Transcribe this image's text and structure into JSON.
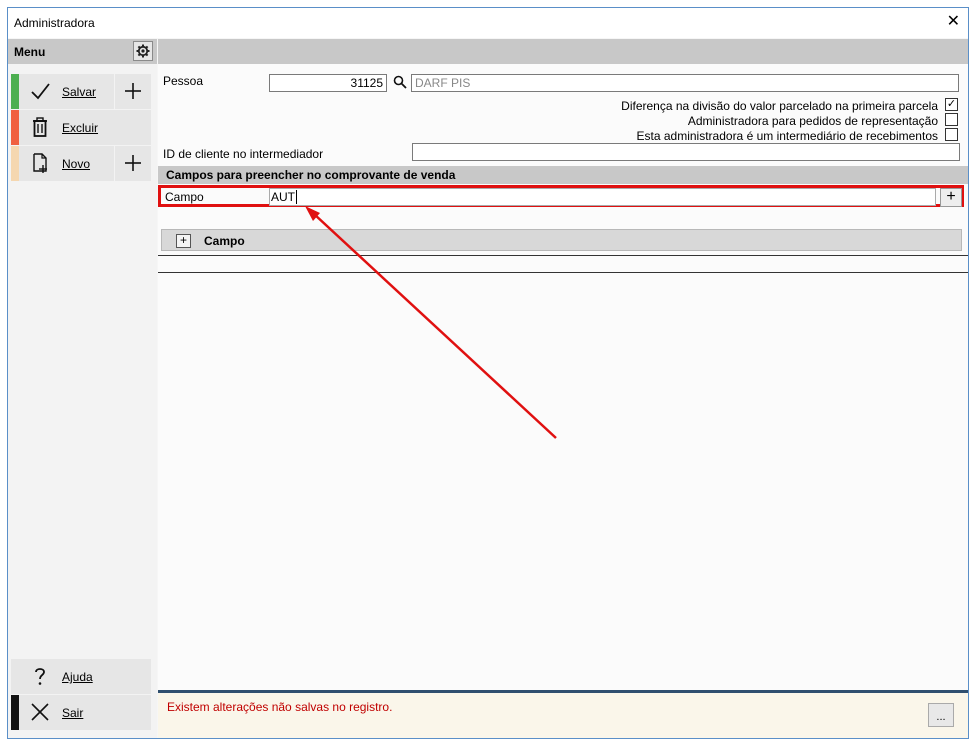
{
  "window": {
    "title": "Administradora",
    "close_glyph": "✕"
  },
  "sidebar": {
    "menu_label": "Menu",
    "settings_icon": "gear-icon",
    "buttons": [
      {
        "label": "Salvar",
        "icon": "check-icon",
        "color": "#4caf50",
        "has_plus": true
      },
      {
        "label": "Excluir",
        "icon": "trash-icon",
        "color": "#f06040",
        "has_plus": false
      },
      {
        "label": "Novo",
        "icon": "new-document-icon",
        "color": "#f5d7b0",
        "has_plus": true
      }
    ],
    "bottom_buttons": [
      {
        "label": "Ajuda",
        "icon": "help-icon"
      },
      {
        "label": "Sair",
        "icon": "close-icon",
        "color": "#111111"
      }
    ]
  },
  "form": {
    "pessoa_label": "Pessoa",
    "pessoa_code": "31125",
    "pessoa_name_placeholder": "DARF PIS",
    "checkboxes": [
      {
        "label": "Diferença na divisão do valor parcelado na primeira parcela",
        "checked": true
      },
      {
        "label": "Administradora para pedidos de representação",
        "checked": false
      },
      {
        "label": "Esta administradora é um intermediário de recebimentos",
        "checked": false
      }
    ],
    "client_id_label": "ID de cliente no intermediador",
    "client_id_value": ""
  },
  "section": {
    "title": "Campos para preencher no comprovante de venda",
    "campo_label": "Campo",
    "campo_value": "AUT",
    "add_glyph": "+"
  },
  "grid": {
    "expand_glyph": "+",
    "column_header": "Campo"
  },
  "status": {
    "message": "Existem alterações não salvas no registro.",
    "ellipsis_label": "..."
  },
  "colors": {
    "annotation_red": "#e01010",
    "status_text": "#c00000"
  }
}
